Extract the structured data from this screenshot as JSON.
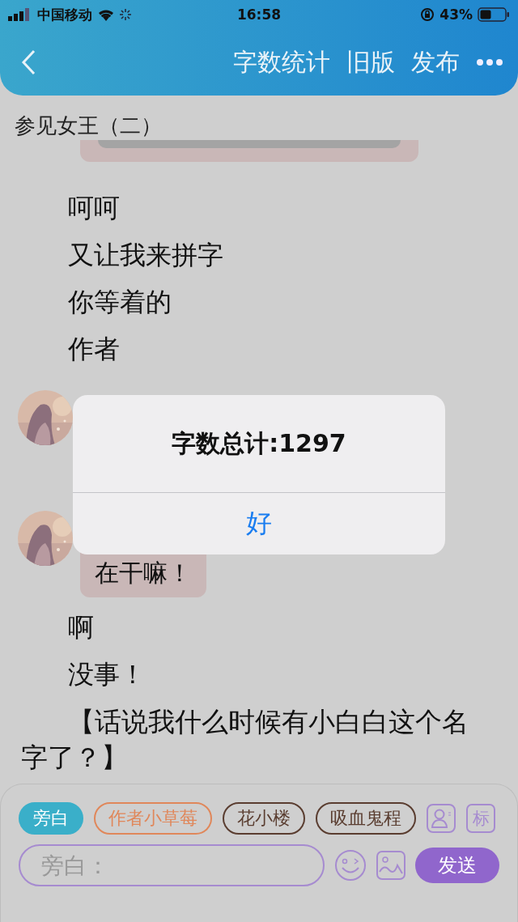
{
  "status_bar": {
    "carrier": "中国移动",
    "time": "16:58",
    "battery": "43%"
  },
  "nav": {
    "actions": [
      "字数统计",
      "旧版",
      "发布"
    ]
  },
  "title": "参见女王（二）",
  "messages": [
    {
      "kind": "cut-bubble"
    },
    {
      "kind": "narration",
      "text": "呵呵"
    },
    {
      "kind": "narration",
      "text": "又让我来拼字"
    },
    {
      "kind": "narration",
      "text": "你等着的"
    },
    {
      "kind": "narration",
      "text": "作者"
    },
    {
      "kind": "role"
    },
    {
      "kind": "role",
      "text": "在干嘛！"
    },
    {
      "kind": "narration",
      "text": "啊"
    },
    {
      "kind": "narration",
      "text": "没事！"
    },
    {
      "kind": "paragraph",
      "text": "【话说我什么时候有小白白这个名字了？】"
    }
  ],
  "roles": [
    {
      "label": "旁白",
      "selected": true,
      "color": "#3aafc9"
    },
    {
      "label": "作者小草莓",
      "selected": false,
      "color": "#e0875a"
    },
    {
      "label": "花小楼",
      "selected": false,
      "color": "#5a3d30"
    },
    {
      "label": "吸血鬼程",
      "selected": false,
      "color": "#5a3d30"
    }
  ],
  "tag_button": "标",
  "input": {
    "placeholder": "旁白："
  },
  "send_button": "发送",
  "dialog": {
    "title": "字数总计:1297",
    "button": "好"
  }
}
